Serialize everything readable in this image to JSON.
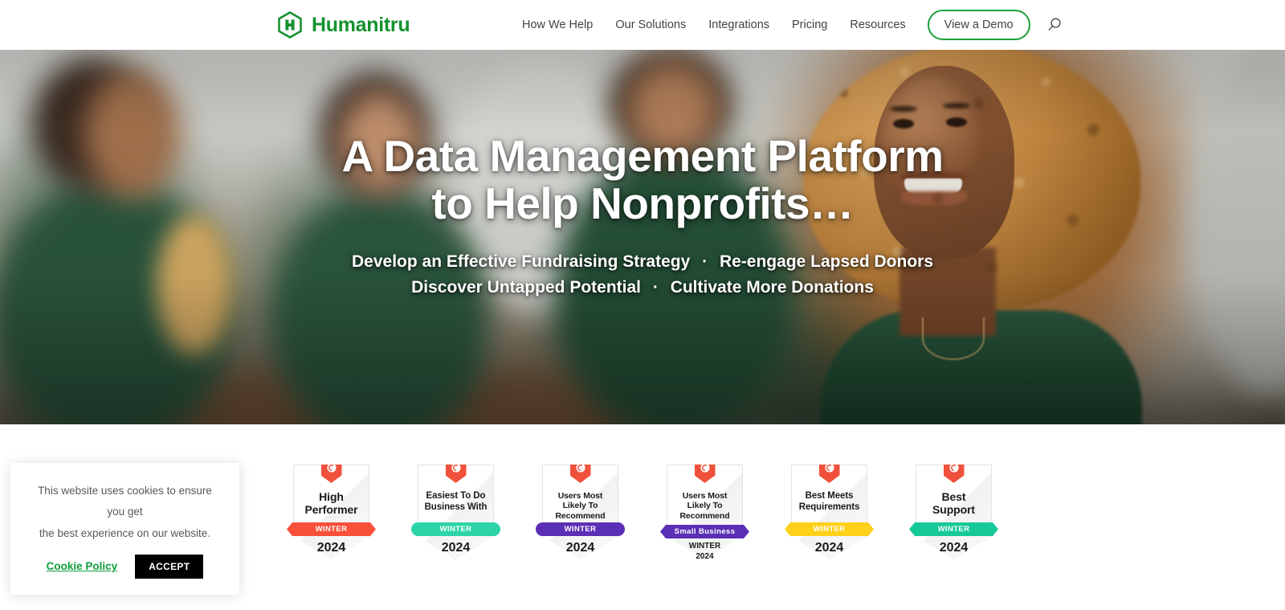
{
  "brand": {
    "name": "Humanitru",
    "logo_icon": "humanitru-hexagon-h-icon",
    "green": "#15922f"
  },
  "header": {
    "nav_items": [
      {
        "label": "How We Help"
      },
      {
        "label": "Our Solutions"
      },
      {
        "label": "Integrations"
      },
      {
        "label": "Pricing"
      },
      {
        "label": "Resources"
      }
    ],
    "demo_button": "View a Demo",
    "search_icon": "search-icon",
    "accent": "#1ba13a"
  },
  "hero": {
    "title_line1": "A Data Management Platform",
    "title_line2": "to Help Nonprofits…",
    "sub_line1_a": "Develop an Effective Fundraising Strategy",
    "sub_sep": "·",
    "sub_line1_b": "Re-engage Lapsed Donors",
    "sub_line2_a": "Discover Untapped Potential",
    "sub_line2_b": "Cultivate More Donations"
  },
  "badges": [
    {
      "title": "High Performer",
      "title_size": "lg",
      "ribbon_label": "WINTER",
      "ribbon_color": "#f9503a",
      "ribbon_shape": "notched",
      "year": "2024",
      "layout": "ribbon-year",
      "logo": "g2-icon"
    },
    {
      "title": "Easiest To Do Business With",
      "title_size": "md",
      "ribbon_label": "WINTER",
      "ribbon_color": "#2dd4a7",
      "ribbon_shape": "rounded",
      "year": "2024",
      "layout": "ribbon-year",
      "logo": "g2-icon"
    },
    {
      "title": "Users Most Likely To Recommend",
      "title_size": "sm",
      "ribbon_label": "WINTER",
      "ribbon_color": "#5b2fb5",
      "ribbon_shape": "rounded",
      "year": "2024",
      "layout": "ribbon-year",
      "logo": "g2-icon"
    },
    {
      "title": "Users Most Likely To Recommend",
      "title_size": "sm",
      "ribbon_label": "Small Business",
      "ribbon_color": "#5b2fb5",
      "ribbon_shape": "notched",
      "season": "WINTER",
      "year": "2024",
      "layout": "ribbon-season-year",
      "logo": "g2-icon"
    },
    {
      "title": "Best Meets Requirements",
      "title_size": "md",
      "ribbon_label": "WINTER",
      "ribbon_color": "#ffd01a",
      "ribbon_shape": "notched",
      "year": "2024",
      "layout": "ribbon-year",
      "logo": "g2-icon"
    },
    {
      "title": "Best Support",
      "title_size": "lg",
      "ribbon_label": "WINTER",
      "ribbon_color": "#17c999",
      "ribbon_shape": "notched",
      "year": "2024",
      "layout": "ribbon-year",
      "logo": "g2-icon"
    }
  ],
  "cookie_banner": {
    "text_line1": "This website uses cookies to ensure you get",
    "text_line2": "the best experience on our website.",
    "policy_link": "Cookie Policy",
    "accept_label": "ACCEPT"
  }
}
